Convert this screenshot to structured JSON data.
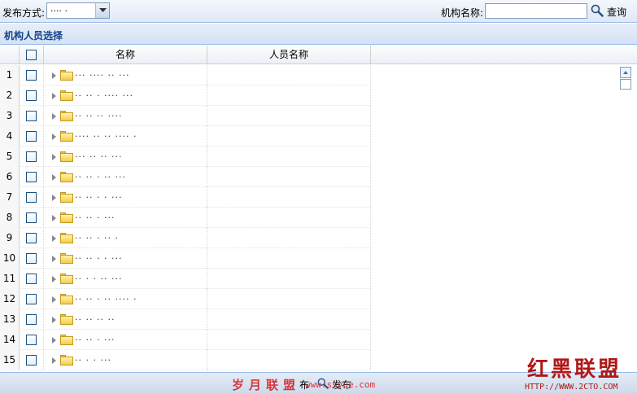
{
  "toolbar": {
    "publish_mode_label": "发布方式:",
    "publish_mode_value": "···· ·",
    "org_name_label": "机构名称:",
    "org_name_value": "",
    "search_label": "查询"
  },
  "panel": {
    "title": "机构人员选择"
  },
  "grid": {
    "columns": [
      "名称",
      "人员名称"
    ],
    "rows": [
      {
        "num": "1",
        "name": "··· ···· ·· ···"
      },
      {
        "num": "2",
        "name": "·· ·· · ···· ···"
      },
      {
        "num": "3",
        "name": "·· ·· ·· ····"
      },
      {
        "num": "4",
        "name": "···· ·· ·· ···· ·"
      },
      {
        "num": "5",
        "name": "··· ·· ·· ···"
      },
      {
        "num": "6",
        "name": "·· ·· · ·· ···"
      },
      {
        "num": "7",
        "name": "·· ·· · · ···"
      },
      {
        "num": "8",
        "name": "·· ·· · ···"
      },
      {
        "num": "9",
        "name": "·· ·· · ·· ·"
      },
      {
        "num": "10",
        "name": "·· ·· · · ···"
      },
      {
        "num": "11",
        "name": "·· · · ·· ···"
      },
      {
        "num": "12",
        "name": "·· ·· · ·· ···· ·"
      },
      {
        "num": "13",
        "name": "·· ·· ·· ··"
      },
      {
        "num": "14",
        "name": "·· ·· · ···"
      },
      {
        "num": "15",
        "name": "·· · · ···"
      }
    ]
  },
  "bottom": {
    "publish_label": "布",
    "cancel_label": "发布"
  },
  "watermark": {
    "left_text": "岁月联盟",
    "left_url": "www.ssyue.com",
    "right_text": "红黑联盟",
    "right_url": "HTTP://WWW.2CTO.COM"
  },
  "colors": {
    "panel_title": "#15428b",
    "header_border": "#99bbe8",
    "watermark_red": "#d6363a"
  }
}
